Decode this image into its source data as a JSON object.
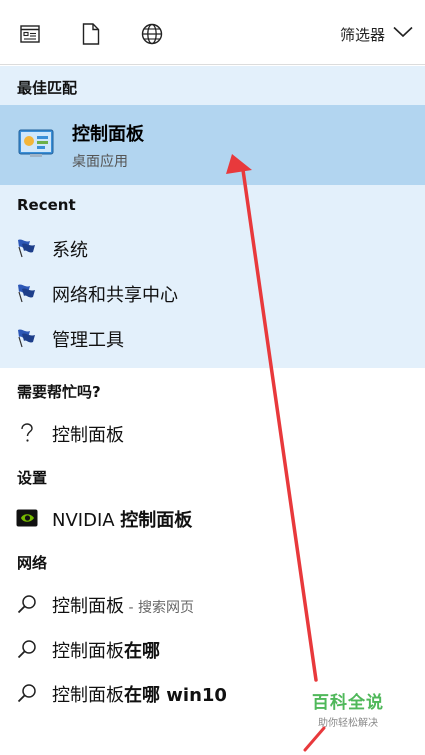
{
  "topbar": {
    "icons": [
      "apps-icon",
      "document-icon",
      "globe-icon"
    ],
    "filter_label": "筛选器"
  },
  "best_match": {
    "header": "最佳匹配",
    "title": "控制面板",
    "subtitle": "桌面应用",
    "icon": "control-panel-icon"
  },
  "recent": {
    "header": "Recent",
    "items": [
      {
        "label": "系统",
        "icon": "flag-icon"
      },
      {
        "label": "网络和共享中心",
        "icon": "flag-icon"
      },
      {
        "label": "管理工具",
        "icon": "flag-icon"
      }
    ]
  },
  "help": {
    "header": "需要帮忙吗?",
    "items": [
      {
        "label": "控制面板",
        "icon": "question-icon"
      }
    ]
  },
  "settings": {
    "header": "设置",
    "items": [
      {
        "prefix": "NVIDIA ",
        "label_bold": "控制面板",
        "icon": "nvidia-icon"
      }
    ]
  },
  "web": {
    "header": "网络",
    "items": [
      {
        "label": "控制面板",
        "suffix": " - 搜索网页",
        "icon": "search-icon"
      },
      {
        "label": "控制面板",
        "label_bold": "在哪",
        "icon": "search-icon"
      },
      {
        "label": "控制面板",
        "label_bold": "在哪 win10",
        "icon": "search-icon"
      }
    ]
  },
  "colors": {
    "best_match_bg": "#b2d5f0",
    "section_bg": "#e3f0fb",
    "arrow": "#e8393c",
    "watermark": "#4fb85a"
  },
  "watermark": {
    "main": "百科全说",
    "sub": "助你轻松解决"
  }
}
